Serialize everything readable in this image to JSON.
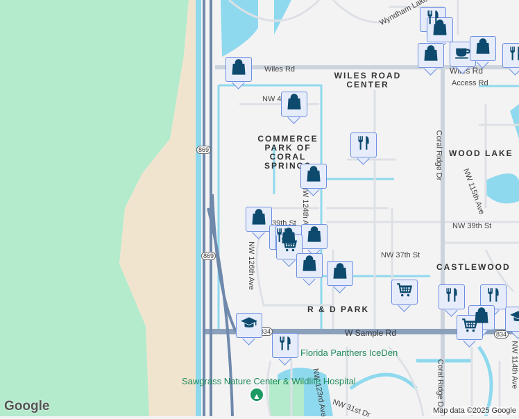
{
  "roads": {
    "wiles_rd": "Wiles Rd",
    "wiles_rd_east": "Wiles Rd",
    "access_rd": "Access Rd",
    "nw4": "NW 4",
    "coral_ridge_dr": "Coral Ridge Dr",
    "coral_ridge_dr_south": "Coral Ridge Dr",
    "nw115": "NW 115th Ave",
    "nw124": "NW 124th Ave",
    "nw39_east": "NW 39th St",
    "nw39_west": "39th St",
    "nw126": "NW 126th Ave",
    "nw37": "NW 37th St",
    "sample_rd": "W Sample Rd",
    "nw123": "NW 123rd Ave",
    "nw31": "NW 31st Dr",
    "nw114": "NW 114th Ave",
    "wyndham": "Wyndham Lakes Blvd S"
  },
  "areas": {
    "wiles_center": "WILES ROAD CENTER",
    "commerce": "COMMERCE PARK OF CORAL SPRINGS",
    "wood_lake": "WOOD LAKE",
    "castlewood": "CASTLEWOOD",
    "rd_park": "R & D PARK"
  },
  "pois": {
    "iceden": "Florida Panthers IceDen",
    "sawgrass": "Sawgrass Nature Center & Wildlife Hospital"
  },
  "shields": {
    "sr869_a": "869",
    "sr869_b": "869",
    "sr834_a": "834",
    "sr834_b": "834"
  },
  "markers": [
    {
      "type": "shopping",
      "icon": "shopping-bag-icon"
    },
    {
      "type": "shopping",
      "icon": "shopping-bag-icon"
    },
    {
      "type": "restaurant",
      "icon": "fork-knife-icon"
    },
    {
      "type": "shopping",
      "icon": "shopping-bag-icon"
    },
    {
      "type": "shopping",
      "icon": "shopping-bag-icon"
    },
    {
      "type": "restaurant",
      "icon": "fork-knife-icon"
    },
    {
      "type": "shopping",
      "icon": "shopping-bag-icon"
    },
    {
      "type": "shopping",
      "icon": "shopping-bag-icon"
    },
    {
      "type": "grocery",
      "icon": "shopping-cart-icon"
    },
    {
      "type": "shopping",
      "icon": "shopping-bag-icon"
    },
    {
      "type": "shopping",
      "icon": "shopping-bag-icon"
    },
    {
      "type": "grocery",
      "icon": "shopping-cart-icon"
    },
    {
      "type": "restaurant",
      "icon": "fork-knife-icon"
    },
    {
      "type": "restaurant",
      "icon": "fork-knife-icon"
    },
    {
      "type": "shopping",
      "icon": "shopping-bag-icon"
    },
    {
      "type": "shopping",
      "icon": "shopping-bag-icon"
    },
    {
      "type": "cafe",
      "icon": "coffee-cup-icon"
    },
    {
      "type": "shopping",
      "icon": "shopping-bag-icon"
    },
    {
      "type": "restaurant",
      "icon": "fork-knife-icon"
    },
    {
      "type": "restaurant",
      "icon": "fork-knife-icon"
    },
    {
      "type": "shopping",
      "icon": "shopping-bag-icon"
    },
    {
      "type": "grocery",
      "icon": "shopping-cart-icon"
    },
    {
      "type": "school",
      "icon": "graduation-cap-icon"
    },
    {
      "type": "school",
      "icon": "graduation-cap-icon"
    },
    {
      "type": "restaurant",
      "icon": "fork-knife-icon"
    }
  ],
  "branding": {
    "logo": "Google",
    "attribution": "Map data ©2025 Google"
  },
  "colors": {
    "water": "#8fd9ee",
    "park": "#b3ebcc",
    "sand": "#f1e4cf",
    "highway": "#7d96b4",
    "road": "#d9dde3",
    "marker_icon": "#0d4a6e"
  }
}
